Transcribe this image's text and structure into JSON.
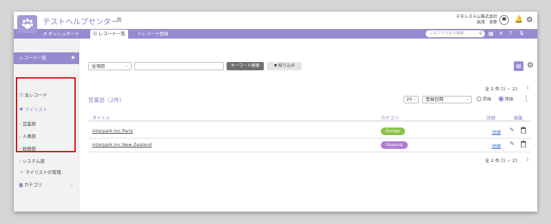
{
  "app": {
    "title": "テストヘルプセンター"
  },
  "user": {
    "company": "デモシステム株式会社",
    "name": "出茂　太郎"
  },
  "nav": {
    "dashboard": "ダッシュボード",
    "record_list": "レコード一覧",
    "record_add": "レコード登録",
    "search_placeholder": "このアプリから検索"
  },
  "sidebar": {
    "header": "レコード一覧",
    "all_records": "全レコード",
    "mylist": "マイリスト",
    "mylist_items": [
      "営業部",
      "人事部",
      "総務部",
      "システム部"
    ],
    "manage_mylist": "マイリストの管理",
    "category": "カテゴリ"
  },
  "toolbar": {
    "field_select": "全項目",
    "keyword_button": "キーワード検索",
    "filter_button": "絞り込み"
  },
  "list": {
    "section_title": "営業部（2件）",
    "count_text": "全 2 件 [1 ~ 2]",
    "page": "1",
    "per_page": "20",
    "sort_field": "登録日時",
    "sort_asc": "昇順",
    "sort_desc": "降順",
    "columns": {
      "title": "タイトル",
      "category": "カテゴリ",
      "detail": "詳細",
      "edit": "編集"
    },
    "rows": [
      {
        "title": "interpark Inc.Paris",
        "category": "Europe",
        "category_color": "#8bc34a",
        "detail": "詳細"
      },
      {
        "title": "interpark Inc.New Zealand",
        "category": "Oceania",
        "category_color": "#b07ad6",
        "detail": "詳細"
      }
    ]
  },
  "colors": {
    "accent": "#978ad0",
    "highlight": "#e01010"
  }
}
